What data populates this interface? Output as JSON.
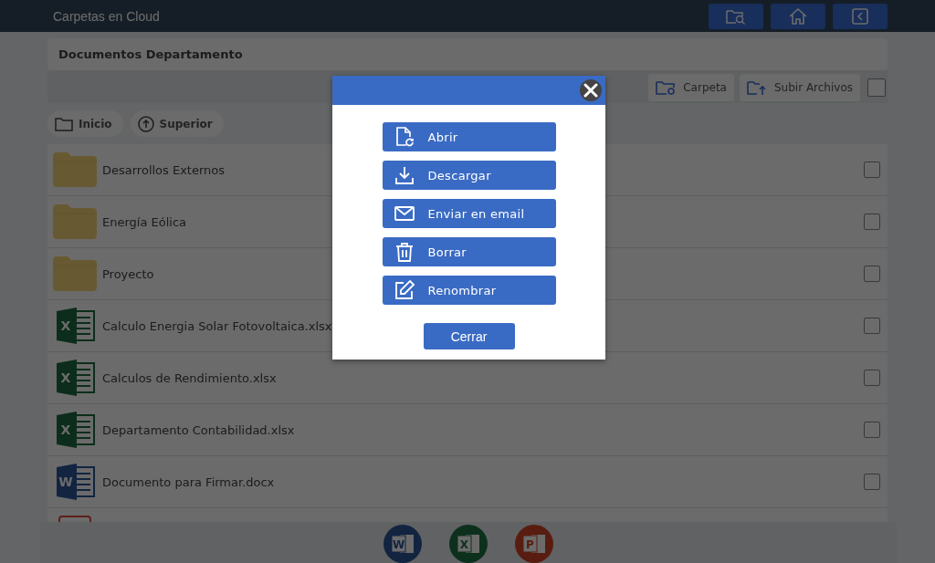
{
  "app": {
    "title": "Carpetas en Cloud"
  },
  "top_buttons": [
    {
      "kind": "folder-search"
    },
    {
      "kind": "home"
    },
    {
      "kind": "back"
    }
  ],
  "path": "Documentos Departamento",
  "toolbar": {
    "buttons": [
      {
        "kind": "new-folder",
        "label": "Carpeta"
      },
      {
        "kind": "upload",
        "label": "Subir Archivos"
      }
    ],
    "select_all": {
      "checked": false
    }
  },
  "nav": [
    {
      "kind": "home",
      "label": "Inicio"
    },
    {
      "kind": "up",
      "label": "Superior"
    }
  ],
  "files": [
    {
      "kind": "folder",
      "name": "Desarrollos Externos",
      "checked": false
    },
    {
      "kind": "folder",
      "name": "Energía Eólica",
      "checked": false
    },
    {
      "kind": "folder",
      "name": "Proyecto",
      "checked": false
    },
    {
      "kind": "excel",
      "icon_letter": "X",
      "name": "Calculo Energia Solar Fotovoltaica.xlsx",
      "checked": false
    },
    {
      "kind": "excel",
      "icon_letter": "X",
      "name": "Calculos de Rendimiento.xlsx",
      "checked": false
    },
    {
      "kind": "excel",
      "icon_letter": "X",
      "name": "Departamento Contabilidad.xlsx",
      "checked": false
    },
    {
      "kind": "word",
      "icon_letter": "W",
      "name": "Documento para Firmar.docx",
      "checked": false
    },
    {
      "kind": "pdf"
    }
  ],
  "dock": [
    {
      "kind": "word",
      "letter": "W"
    },
    {
      "kind": "excel",
      "letter": "X"
    },
    {
      "kind": "powerpoint",
      "letter": "P"
    }
  ],
  "dialog": {
    "actions": [
      {
        "kind": "open",
        "label": "Abrir"
      },
      {
        "kind": "download",
        "label": "Descargar"
      },
      {
        "kind": "email",
        "label": "Enviar en email"
      },
      {
        "kind": "delete",
        "label": "Borrar"
      },
      {
        "kind": "rename",
        "label": "Renombrar"
      }
    ],
    "close_label": "Cerrar"
  }
}
